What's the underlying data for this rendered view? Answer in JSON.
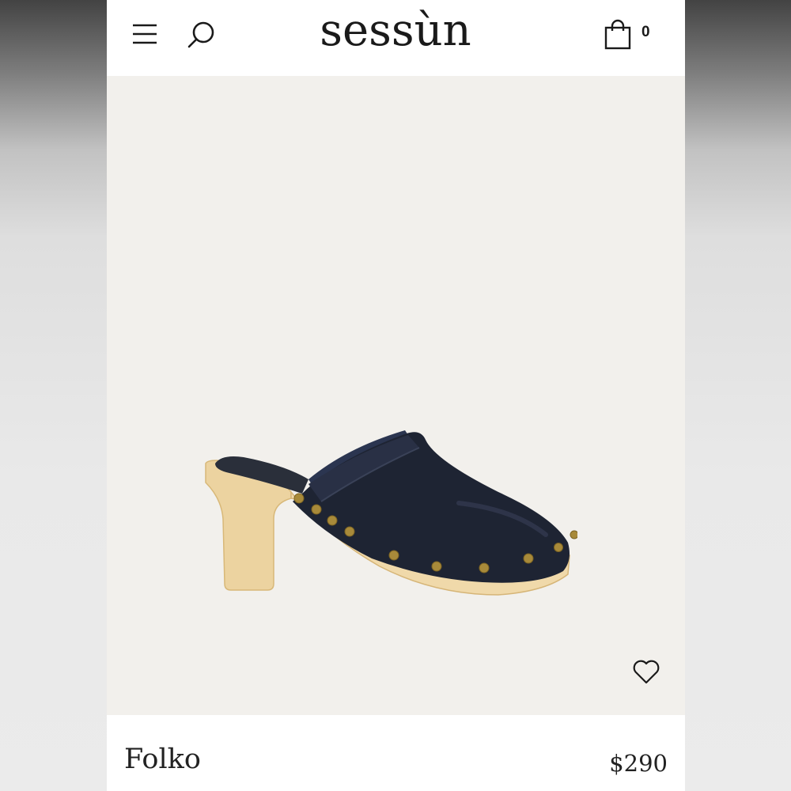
{
  "header": {
    "logo_text": "sessùn",
    "menu_icon": "hamburger-menu-icon",
    "search_icon": "search-icon",
    "cart_icon": "shopping-bag-icon",
    "cart_count": "0"
  },
  "product": {
    "name": "Folko",
    "price": "$290",
    "favorite_icon": "heart-outline-icon",
    "image_description_icon": "product-photo"
  },
  "colors": {
    "header_background": "#ffffff",
    "image_background": "#f2f0ec",
    "text": "#1a1a1a",
    "shoe_leather": "#1c2230",
    "wood_sole": "#e9cf98",
    "studs": "#a88a3a"
  }
}
